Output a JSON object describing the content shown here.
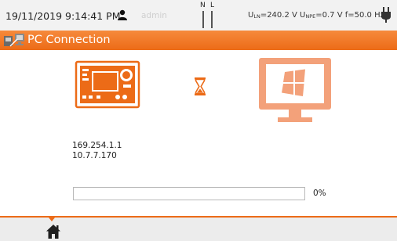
{
  "status_bar": {
    "datetime": "19/11/2019 9:14:41 PM",
    "user": "admin",
    "n_label": "N",
    "l_label": "L",
    "u_ln_value": "=240.2 V",
    "u_npe_value": "=0.7 V",
    "frequency": "f=50.0 Hz",
    "icons": [
      "user-icon",
      "plug-icon"
    ]
  },
  "header": {
    "title": "PC Connection",
    "icon": "pc-connection-icon",
    "accent_color": "#ec6b17"
  },
  "connection": {
    "device_icon": "meter-device-icon",
    "state_icon": "hourglass-icon",
    "pc_icon": "pc-monitor-icon",
    "ip_addresses": [
      "169.254.1.1",
      "10.7.7.170"
    ]
  },
  "progress": {
    "value": 0,
    "label": "0%"
  },
  "footer": {
    "home_icon": "home-icon"
  }
}
